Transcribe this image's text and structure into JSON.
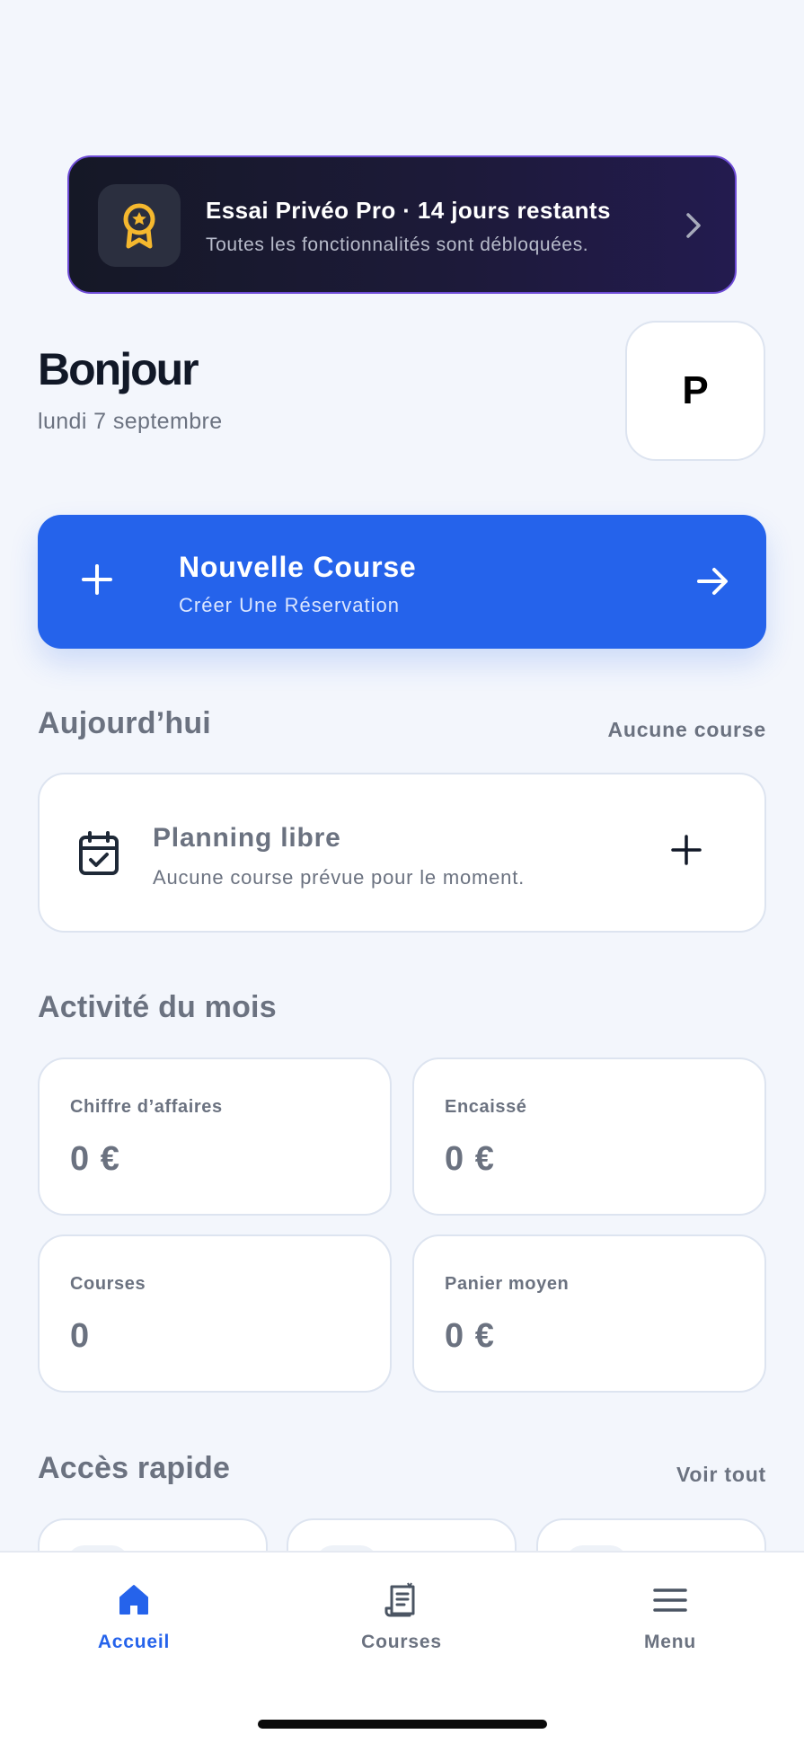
{
  "trial": {
    "title": "Essai Privéo Pro · 14 jours restants",
    "subtitle": "Toutes les fonctionnalités sont débloquées.",
    "icon": "award-badge-icon"
  },
  "greeting": {
    "title": "Bonjour",
    "date": "lundi 7 septembre",
    "avatar_initial": "P"
  },
  "new_ride": {
    "title": "Nouvelle Course",
    "subtitle": "Créer Une Réservation"
  },
  "today": {
    "title": "Aujourd’hui",
    "status": "Aucune course",
    "card_title": "Planning libre",
    "card_subtitle": "Aucune course prévue pour le moment."
  },
  "activity": {
    "title": "Activité du mois",
    "stats": [
      {
        "label": "Chiffre d’affaires",
        "value": "0 €"
      },
      {
        "label": "Encaissé",
        "value": "0 €"
      },
      {
        "label": "Courses",
        "value": "0"
      },
      {
        "label": "Panier moyen",
        "value": "0 €"
      }
    ]
  },
  "quick_access": {
    "title": "Accès rapide",
    "link": "Voir tout"
  },
  "tabs": [
    {
      "label": "Accueil",
      "icon": "home-icon",
      "active": true
    },
    {
      "label": "Courses",
      "icon": "receipt-icon",
      "active": false
    },
    {
      "label": "Menu",
      "icon": "menu-icon",
      "active": false
    }
  ],
  "colors": {
    "accent": "#2563eb",
    "trial_border": "#6d4bd6",
    "badge_gold": "#f5b82e",
    "background": "#f3f6fc"
  }
}
